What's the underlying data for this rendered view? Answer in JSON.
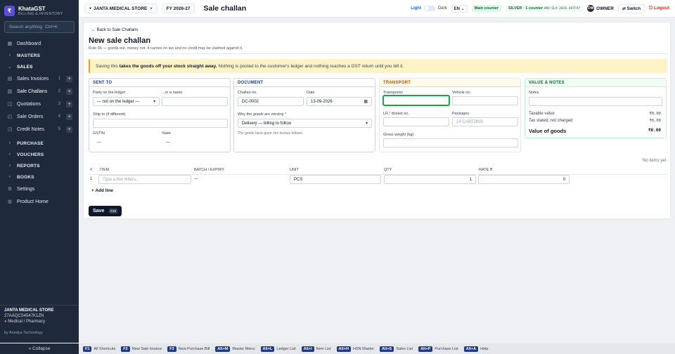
{
  "brand": {
    "name": "KhataGST",
    "sub": "BILLING & INVENTORY",
    "logo": "₹"
  },
  "search": {
    "placeholder": "Search anything",
    "shortcut": "Ctrl+K"
  },
  "nav": {
    "dashboard": "Dashboard",
    "masters": "MASTERS",
    "sales": "SALES",
    "sales_items": [
      {
        "label": "Sales Invoices",
        "count": "1"
      },
      {
        "label": "Sale Challans",
        "count": "2"
      },
      {
        "label": "Quotations",
        "count": "3"
      },
      {
        "label": "Sale Orders",
        "count": "4"
      },
      {
        "label": "Credit Notes",
        "count": "5"
      }
    ],
    "purchase": "PURCHASE",
    "vouchers": "VOUCHERS",
    "reports": "REPORTS",
    "books": "BOOKS",
    "settings": "Settings",
    "product_home": "Product Home"
  },
  "sidebar_footer": {
    "company": "JANTA MEDICAL STORE",
    "gstin": "27AAQCS4547K1ZN",
    "industry": "Medical / Pharmacy",
    "by": "by Anedya Technology",
    "collapse": "« Collapse"
  },
  "topbar": {
    "company": "JANTA MEDICAL STORE",
    "fy": "FY 2026-27",
    "title": "Sale challan",
    "light": "Light",
    "dark": "Dark",
    "lang": "EN",
    "main_counter": "Main counter",
    "plan": "SILVER · 1 counter",
    "plan_code": "ANO-SLV-2026-487F97",
    "avatar": "OW",
    "owner": "OWNER",
    "switch": "Switch",
    "logout": "Logout"
  },
  "page": {
    "back": "← Back to Sale Challans",
    "title": "New sale challan",
    "rule": "Rule 55 — goods out, money not. It carries no tax and no credit may be claimed against it.",
    "notice_pre": "Saving this ",
    "notice_bold": "takes the goods off your stock straight away.",
    "notice_post": " Nothing is posted to the customer's ledger and nothing reaches a GST return until you bill it."
  },
  "sent_to": {
    "header": "SENT TO",
    "party_label": "Party on the ledger",
    "party_value": "— not on the ledger —",
    "name_label": "...or a name",
    "ship_label": "Ship to (if different)",
    "gstin_label": "GSTIN",
    "gstin_value": "—",
    "state_label": "State",
    "state_value": "—"
  },
  "document": {
    "header": "DOCUMENT",
    "challan_label": "Challan no.",
    "challan_value": "DC-0002",
    "date_label": "Date",
    "date_value": "13-09-2026",
    "why_label": "Why the goods are moving *",
    "why_value": "Delivery — billing to follow",
    "hint": "The goods have gone; the invoice follows."
  },
  "transport": {
    "header": "TRANSPORT",
    "transporter_label": "Transporter",
    "vehicle_label": "Vehicle no.",
    "lr_label": "LR / docket no.",
    "packages_label": "Packages",
    "packages_placeholder": "14 CARTONS",
    "weight_label": "Gross weight (kg)"
  },
  "value_notes": {
    "header": "VALUE & NOTES",
    "notes_label": "Notes",
    "taxable_label": "Taxable value",
    "taxable_value": "₹0.00",
    "tax_label": "Tax stated, not charged",
    "tax_value": "₹0.00",
    "total_label": "Value of goods",
    "total_value": "₹0.00"
  },
  "items": {
    "empty": "No items yet",
    "headers": {
      "num": "#",
      "item": "ITEM",
      "batch": "BATCH / EXPIRY",
      "unit": "UNIT",
      "qty": "QTY",
      "rate": "RATE ₹"
    },
    "row": {
      "num": "1",
      "item_placeholder": "Type a few letters...",
      "batch": "—",
      "unit": "PCS",
      "qty": "1",
      "rate": "0"
    },
    "add_line": "+ Add line"
  },
  "save": {
    "label": "Save",
    "key": "F10"
  },
  "shortcuts": [
    {
      "key": "F1",
      "label": "All Shortcuts"
    },
    {
      "key": "F2",
      "label": "New Sale Invoice"
    },
    {
      "key": "F3",
      "label": "New Purchase Bill"
    },
    {
      "key": "Alt+M",
      "label": "Master Menu"
    },
    {
      "key": "Alt+L",
      "label": "Ledger List"
    },
    {
      "key": "Alt+I",
      "label": "Item List"
    },
    {
      "key": "Alt+H",
      "label": "HSN Master"
    },
    {
      "key": "Alt+S",
      "label": "Sales List"
    },
    {
      "key": "Alt+P",
      "label": "Purchase List"
    },
    {
      "key": "Alt+A",
      "label": "Help"
    }
  ],
  "colors": {
    "sidebar": "#1e293b",
    "accent": "#5b4fcf",
    "focus": "#16a34a",
    "notice": "#fef3c7"
  }
}
